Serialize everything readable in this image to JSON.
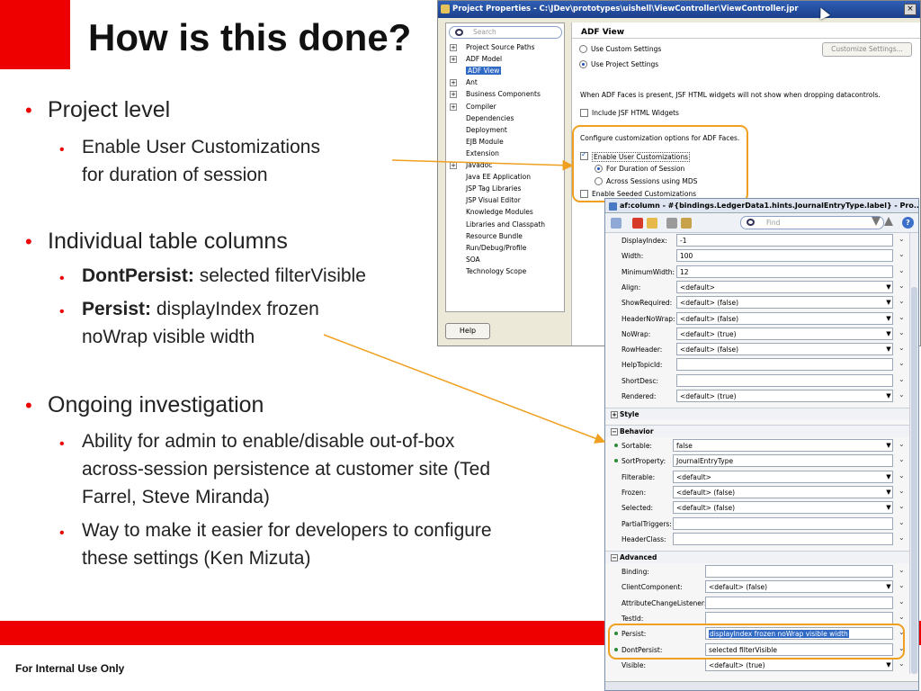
{
  "slide": {
    "title": "How is this done?",
    "footer": "For Internal Use Only",
    "bullets": [
      {
        "text": "Project level",
        "subs": [
          {
            "lines": [
              "Enable User Customizations",
              "for duration of session"
            ]
          }
        ]
      },
      {
        "text": "Individual table columns",
        "subs": [
          {
            "bold": "DontPersist:",
            "rest": " selected filterVisible"
          },
          {
            "bold": "Persist:",
            "rest": " displayIndex frozen",
            "line2": "noWrap visible width"
          }
        ]
      },
      {
        "text": "Ongoing investigation",
        "subs": [
          {
            "lines": [
              "Ability for admin to enable/disable out-of-box",
              "across-session persistence at customer site (Ted",
              "Farrel, Steve Miranda)"
            ]
          },
          {
            "lines": [
              "Way to make it easier for developers to configure",
              "these settings (Ken Mizuta)"
            ]
          }
        ]
      }
    ]
  },
  "dialog": {
    "title": "Project Properties - C:\\JDev\\prototypes\\uishell\\ViewController\\ViewController.jpr",
    "close": "×",
    "search_placeholder": "Search",
    "tree": [
      {
        "label": "Project Source Paths",
        "expandable": true
      },
      {
        "label": "ADF Model",
        "expandable": true
      },
      {
        "label": "ADF View",
        "selected": true
      },
      {
        "label": "Ant",
        "expandable": true
      },
      {
        "label": "Business Components",
        "expandable": true
      },
      {
        "label": "Compiler",
        "expandable": true
      },
      {
        "label": "Dependencies"
      },
      {
        "label": "Deployment"
      },
      {
        "label": "EJB Module"
      },
      {
        "label": "Extension"
      },
      {
        "label": "Javadoc",
        "expandable": true
      },
      {
        "label": "Java EE Application"
      },
      {
        "label": "JSP Tag Libraries"
      },
      {
        "label": "JSP Visual Editor"
      },
      {
        "label": "Knowledge Modules"
      },
      {
        "label": "Libraries and Classpath"
      },
      {
        "label": "Resource Bundle"
      },
      {
        "label": "Run/Debug/Profile"
      },
      {
        "label": "SOA"
      },
      {
        "label": "Technology Scope"
      }
    ],
    "help": "Help",
    "panel_title": "ADF View",
    "use_custom": "Use Custom Settings",
    "use_project": "Use Project Settings",
    "customize_btn": "Customize Settings...",
    "info": "When ADF Faces is present, JSF HTML widgets will not show when dropping datacontrols.",
    "include_jsf": "Include JSF HTML Widgets",
    "configure": "Configure customization options for ADF Faces.",
    "enable_user": "Enable User Customizations",
    "for_duration": "For Duration of Session",
    "across_sessions": "Across Sessions using MDS",
    "enable_seeded": "Enable Seeded Customizations"
  },
  "inspector": {
    "title": "af:column - #{bindings.LedgerData1.hints.JournalEntryType.label} - Pro...",
    "find_placeholder": "Find",
    "help": "?",
    "rows_top": [
      {
        "label": "DisplayIndex:",
        "value": "-1"
      },
      {
        "label": "Width:",
        "value": "100"
      },
      {
        "label": "MinimumWidth:",
        "value": "12"
      },
      {
        "label": "Align:",
        "value": "<default>",
        "dropdown": true
      },
      {
        "label": "ShowRequired:",
        "value": "<default> (false)",
        "dropdown": true
      },
      {
        "label": "HeaderNoWrap:",
        "value": "<default> (false)",
        "dropdown": true
      },
      {
        "label": "NoWrap:",
        "value": "<default> (true)",
        "dropdown": true
      },
      {
        "label": "RowHeader:",
        "value": "<default> (false)",
        "dropdown": true
      },
      {
        "label": "HelpTopicId:",
        "value": ""
      },
      {
        "label": "ShortDesc:",
        "value": ""
      },
      {
        "label": "Rendered:",
        "value": "<default> (true)",
        "dropdown": true
      }
    ],
    "section_style": "Style",
    "section_behavior": "Behavior",
    "rows_behavior": [
      {
        "label": "Sortable:",
        "value": "false",
        "dropdown": true,
        "dot": true
      },
      {
        "label": "SortProperty:",
        "value": "JournalEntryType",
        "dot": true
      },
      {
        "label": "Filterable:",
        "value": "<default>",
        "dropdown": true
      },
      {
        "label": "Frozen:",
        "value": "<default> (false)",
        "dropdown": true
      },
      {
        "label": "Selected:",
        "value": "<default> (false)",
        "dropdown": true
      },
      {
        "label": "PartialTriggers:",
        "value": ""
      },
      {
        "label": "HeaderClass:",
        "value": ""
      }
    ],
    "section_advanced": "Advanced",
    "rows_advanced": [
      {
        "label": "Binding:",
        "value": ""
      },
      {
        "label": "ClientComponent:",
        "value": "<default> (false)",
        "dropdown": true
      },
      {
        "label": "AttributeChangeListener:",
        "value": ""
      },
      {
        "label": "TestId:",
        "value": ""
      },
      {
        "label": "Persist:",
        "value": "displayIndex frozen noWrap visible width",
        "dot": true,
        "selected": true
      },
      {
        "label": "DontPersist:",
        "value": "selected filterVisible",
        "dot": true
      },
      {
        "label": "Visible:",
        "value": "<default> (true)",
        "dropdown": true
      }
    ]
  },
  "colors": {
    "accent_red": "#ee0000",
    "highlight_orange": "#f0a020",
    "selection_blue": "#316ac5"
  }
}
